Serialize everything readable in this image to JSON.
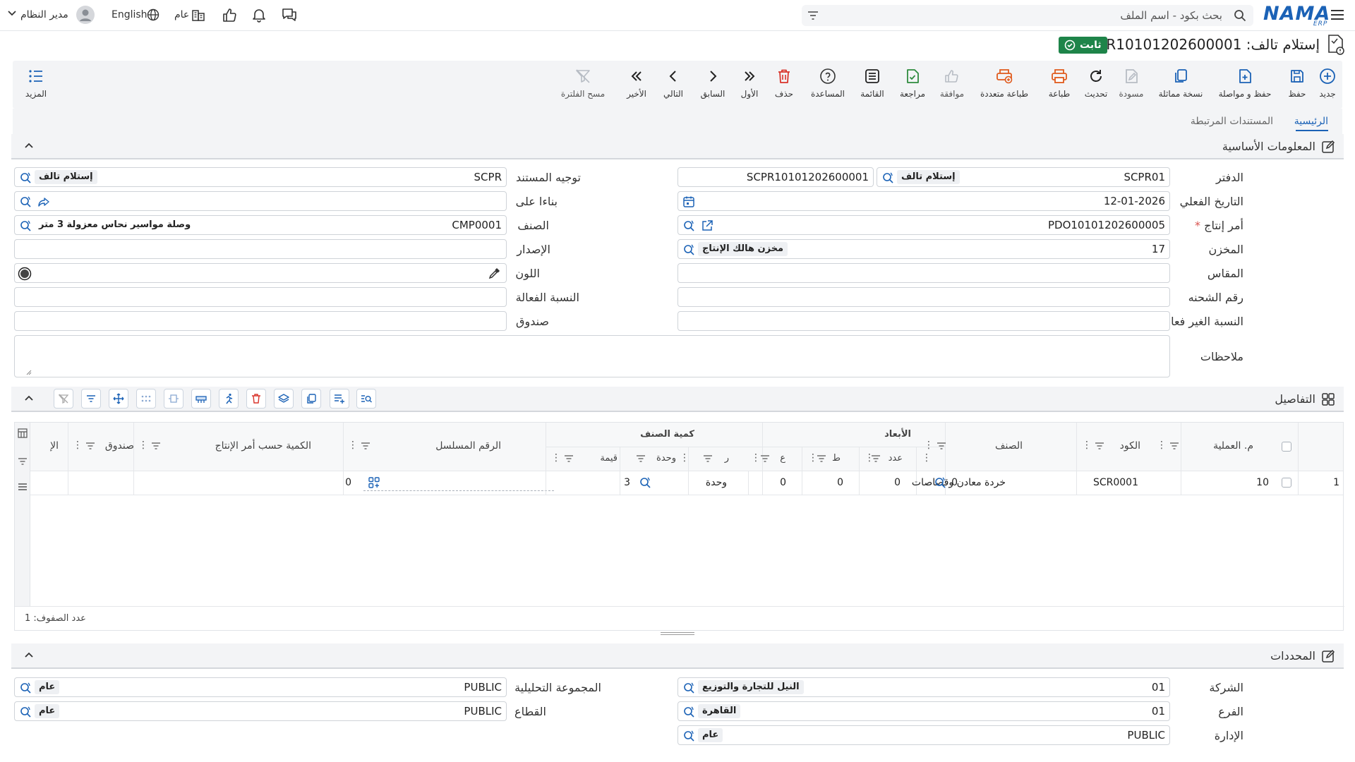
{
  "topbar": {
    "search_placeholder": "بحث بكود - اسم الملف",
    "logo": "NAMA",
    "logo_sub": "ERP",
    "user": "مدير النظام",
    "language": "English",
    "scope": "عام"
  },
  "page": {
    "title": "إستلام تالف: SCPR10101202600001",
    "status": "ثابت"
  },
  "toolbar": {
    "new": "جديد",
    "save": "حفظ",
    "save_continue": "حفظ و مواصلة",
    "copy": "نسخة مماثلة",
    "draft": "مسودة",
    "refresh": "تحديث",
    "print": "طباعة",
    "multi_print": "طباعة متعددة",
    "approve": "موافقة",
    "review": "مراجعة",
    "list": "القائمة",
    "help": "المساعدة",
    "delete": "حذف",
    "first": "الأول",
    "previous": "السابق",
    "next": "التالي",
    "last": "الأخير",
    "clear_filter": "مسح الفلترة",
    "more": "المزيد"
  },
  "tabs": {
    "main": "الرئيسية",
    "related": "المستندات المرتبطة"
  },
  "basic_info": {
    "title": "المعلومات الأساسية",
    "book_label": "الدفتر",
    "book_code": "SCPR01",
    "book_name": "إستلام تالف",
    "doc_no": "SCPR10101202600001",
    "date_label": "التاريخ الفعلي",
    "date": "12-01-2026",
    "order_label": "أمر إنتاج",
    "order": "PDO10101202600005",
    "warehouse_label": "المخزن",
    "warehouse_code": "17",
    "warehouse_name": "مخزن هالك الإنتاج",
    "size_label": "المقاس",
    "batch_label": "رقم الشحنه",
    "inactive_ratio_label": "النسبة الغير فعالة",
    "notes_label": "ملاحظات",
    "direction_label": "توجيه المستند",
    "direction_code": "SCPR",
    "direction_name": "إستلام تالف",
    "based_on_label": "بناءا على",
    "item_label": "الصنف",
    "item_code": "CMP0001",
    "item_name": "وصلة مواسير نحاس معزولة 3 متر",
    "version_label": "الإصدار",
    "color_label": "اللون",
    "active_ratio_label": "النسبة الفعالة",
    "box_label": "صندوق"
  },
  "details": {
    "title": "التفاصيل",
    "headers": {
      "op_no": "م. العملية",
      "code": "الكود",
      "item": "الصنف",
      "dimensions": "الأبعاد",
      "count": "عدد",
      "length": "ط",
      "width": "ع",
      "height": "ر",
      "item_qty": "كمية الصنف",
      "unit": "وحدة",
      "value": "قيمة",
      "serial": "الرقم المسلسل",
      "prod_qty": "الكمية حسب أمر الإنتاج",
      "box": "صندوق",
      "more": "الإ"
    },
    "rows": [
      {
        "index": "1",
        "op_no": "10",
        "code": "SCR0001",
        "item": "خردة معادن وقصاصات",
        "count": "0",
        "length": "0",
        "width": "0",
        "height": "0",
        "unit": "وحدة",
        "value": "3",
        "prod_qty": "0"
      }
    ],
    "row_count": "عدد الصفوف: 1"
  },
  "determinants": {
    "title": "المحددات",
    "company_label": "الشركة",
    "company_code": "01",
    "company_name": "النيل للتجارة والتوزيع",
    "branch_label": "الفرع",
    "branch_code": "01",
    "branch_name": "القاهرة",
    "dept_label": "الإدارة",
    "dept_code": "PUBLIC",
    "dept_name": "عام",
    "analytic_label": "المجموعة التحليلية",
    "analytic_code": "PUBLIC",
    "analytic_name": "عام",
    "sector_label": "القطاع",
    "sector_code": "PUBLIC",
    "sector_name": "عام"
  },
  "colors": {
    "accent": "#1b62b6",
    "status_green": "#1e8449",
    "print_orange": "#e05a1c",
    "review_green": "#2e8b3e",
    "delete_red": "#d9342b"
  }
}
